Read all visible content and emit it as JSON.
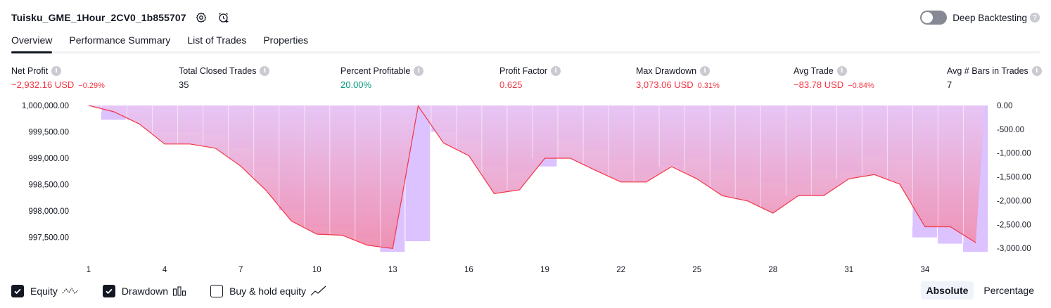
{
  "header": {
    "strategy_name": "Tuisku_GME_1Hour_2CV0_1b855707",
    "deep_backtesting_label": "Deep Backtesting",
    "help_mark": "?"
  },
  "tabs": [
    {
      "label": "Overview",
      "active": true
    },
    {
      "label": "Performance Summary",
      "active": false
    },
    {
      "label": "List of Trades",
      "active": false
    },
    {
      "label": "Properties",
      "active": false
    }
  ],
  "info_mark": "i",
  "metrics": [
    {
      "label": "Net Profit",
      "value": "−2,932.16 USD",
      "pct": "−0.29%",
      "tone": "neg"
    },
    {
      "label": "Total Closed Trades",
      "value": "35",
      "pct": "",
      "tone": "neu"
    },
    {
      "label": "Percent Profitable",
      "value": "20.00%",
      "pct": "",
      "tone": "pos"
    },
    {
      "label": "Profit Factor",
      "value": "0.625",
      "pct": "",
      "tone": "neg"
    },
    {
      "label": "Max Drawdown",
      "value": "3,073.06 USD",
      "pct": "0.31%",
      "tone": "neg"
    },
    {
      "label": "Avg Trade",
      "value": "−83.78 USD",
      "pct": "−0.84%",
      "tone": "neg"
    },
    {
      "label": "Avg # Bars in Trades",
      "value": "7",
      "pct": "",
      "tone": "neu"
    }
  ],
  "chart_data": {
    "type": "bar",
    "x": [
      1,
      2,
      3,
      4,
      5,
      6,
      7,
      8,
      9,
      10,
      11,
      12,
      13,
      14,
      15,
      16,
      17,
      18,
      19,
      20,
      21,
      22,
      23,
      24,
      25,
      26,
      27,
      28,
      29,
      30,
      31,
      32,
      33,
      34,
      35,
      36
    ],
    "x_tick_labels": [
      "1",
      "4",
      "7",
      "10",
      "13",
      "16",
      "19",
      "22",
      "25",
      "28",
      "31",
      "34"
    ],
    "y_left_ticks": [
      "1,000,000.00",
      "999,500.00",
      "999,000.00",
      "998,500.00",
      "998,000.00",
      "997,500.00"
    ],
    "y_left_values": [
      1000000,
      999500,
      999000,
      998500,
      998000,
      997500
    ],
    "y_left_range": [
      997200,
      1000000
    ],
    "y_right_ticks": [
      "0.00",
      "-500.00",
      "-1,000.00",
      "-1,500.00",
      "-2,000.00",
      "-2,500.00",
      "-3,000.00"
    ],
    "y_right_values": [
      0,
      -500,
      -1000,
      -1500,
      -2000,
      -2500,
      -3000
    ],
    "y_right_range": [
      -3100,
      0
    ],
    "series": [
      {
        "name": "Equity",
        "values": [
          1000000,
          999880,
          999650,
          999270,
          999270,
          999190,
          998850,
          998390,
          997810,
          997560,
          997540,
          997350,
          997290,
          999990,
          999290,
          999050,
          998330,
          998400,
          999000,
          999000,
          998770,
          998550,
          998550,
          998840,
          998610,
          998290,
          998190,
          997960,
          998290,
          998290,
          998610,
          998690,
          998510,
          997700,
          997700,
          997400
        ]
      },
      {
        "name": "Drawdown",
        "values": [
          0,
          -300,
          -300,
          -550,
          -550,
          -600,
          -900,
          -1300,
          -2200,
          -2550,
          -2600,
          -2780,
          -3073,
          -2850,
          -550,
          -730,
          -1280,
          -1380,
          -1280,
          -730,
          -950,
          -1150,
          -1450,
          -1250,
          -1100,
          -1350,
          -1500,
          -1620,
          -1680,
          -1350,
          -1400,
          -1050,
          -1150,
          -2770,
          -2900,
          -3073
        ]
      }
    ]
  },
  "footer": {
    "equity_label": "Equity",
    "drawdown_label": "Drawdown",
    "buyhold_label": "Buy & hold equity",
    "absolute_label": "Absolute",
    "percentage_label": "Percentage"
  },
  "colors": {
    "equity_line": "#f23645",
    "drawdown_bar": "#dcc2ff",
    "area_top": "#e7c6f5",
    "area_bottom": "#f08fb0",
    "area_light": "#ffd4c4",
    "accent_line": "#2962ff"
  }
}
